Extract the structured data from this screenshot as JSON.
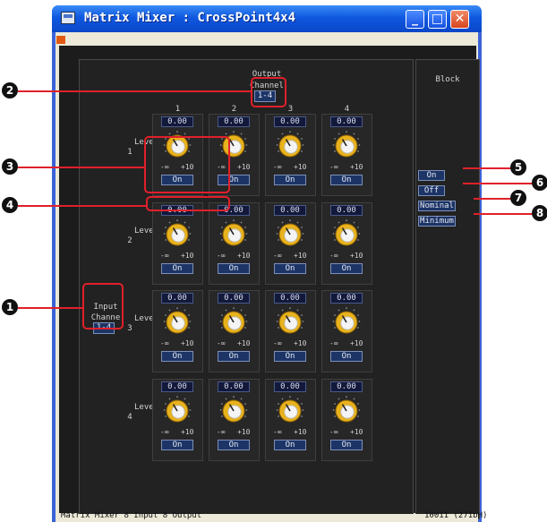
{
  "window": {
    "title": "Matrix Mixer : CrossPoint4x4",
    "minimize": "_",
    "maximize": "□",
    "close": "✕"
  },
  "output": {
    "line1": "Output",
    "line2": "Channel",
    "channel_button": "1-4",
    "columns": [
      "1",
      "2",
      "3",
      "4"
    ]
  },
  "input": {
    "line1": "Input",
    "line2": "Channe",
    "channel_button": "1-4",
    "rows": [
      "1",
      "2",
      "3",
      "4"
    ]
  },
  "cell_template": {
    "level_label": "Level",
    "min_label": "-∞",
    "max_label": "+10"
  },
  "cells": [
    [
      "0.00",
      "0.00",
      "0.00",
      "0.00"
    ],
    [
      "0.00",
      "0.00",
      "0.00",
      "0.00"
    ],
    [
      "0.00",
      "0.00",
      "0.00",
      "0.00"
    ],
    [
      "0.00",
      "0.00",
      "0.00",
      "0.00"
    ]
  ],
  "on_buttons": [
    [
      "On",
      "On",
      "On",
      "On"
    ],
    [
      "On",
      "On",
      "On",
      "On"
    ],
    [
      "On",
      "On",
      "On",
      "On"
    ],
    [
      "On",
      "On",
      "On",
      "On"
    ]
  ],
  "block": {
    "title": "Block",
    "buttons": [
      "On",
      "Off",
      "Nominal",
      "Minimum"
    ]
  },
  "status": {
    "left": "Matrix Mixer  8 Input 8 Output",
    "right": "10011 (271bH)"
  },
  "callouts": [
    "1",
    "2",
    "3",
    "4",
    "5",
    "6",
    "7",
    "8"
  ],
  "colors": {
    "panel": "#1c1c1c",
    "value_box": "#12193a",
    "knob": "#e8b21c",
    "callout_red": "#e0202a",
    "titlebar": "#0f58e0"
  }
}
